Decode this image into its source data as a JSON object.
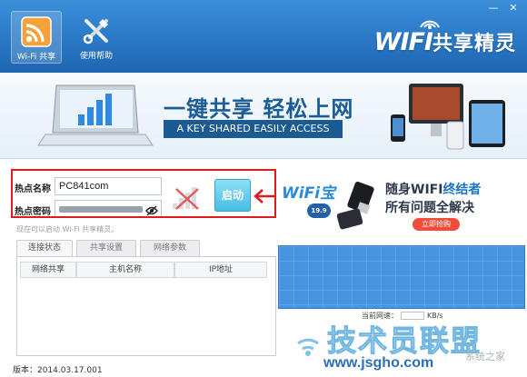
{
  "toolbar": {
    "buttons": [
      {
        "label": "Wi-Fi 共享",
        "icon": "wifi-share-icon",
        "active": true
      },
      {
        "label": "使用帮助",
        "icon": "tools-icon",
        "active": false
      }
    ],
    "brand": {
      "latin": "WIFI",
      "cn": "共享精灵"
    },
    "window_controls": {
      "minimize": "—",
      "close": "✕"
    },
    "colors": {
      "bar": "#2a78c6"
    }
  },
  "banner": {
    "title": "一键共享  轻松上网",
    "subtitle": "A KEY SHARED EASILY ACCESS"
  },
  "form": {
    "ssid_label": "热点名称",
    "ssid_value": "PC841com",
    "password_label": "热点密码",
    "start_button": "启动",
    "hint": "现在可以启动 Wi-Fi 共享精灵。",
    "highlight_color": "#e01b1b"
  },
  "tabs": [
    "连接状态",
    "共享设置",
    "网络参数"
  ],
  "table": {
    "columns": [
      "网络共享",
      "主机名称",
      "IP地址"
    ]
  },
  "version": "版本：2014.03.17.001",
  "ad": {
    "logo": "WiFi宝",
    "price": "19.9",
    "line1_prefix": "随身WIFI",
    "line1_highlight": "终结者",
    "line2": "所有问题全解决",
    "buy_button": "立即抢购"
  },
  "speed": {
    "label": "当前网速：",
    "unit": "KB/s"
  },
  "watermark": {
    "main": "技术员联盟",
    "url": "www.jsgho.com",
    "right": "系统之家"
  }
}
